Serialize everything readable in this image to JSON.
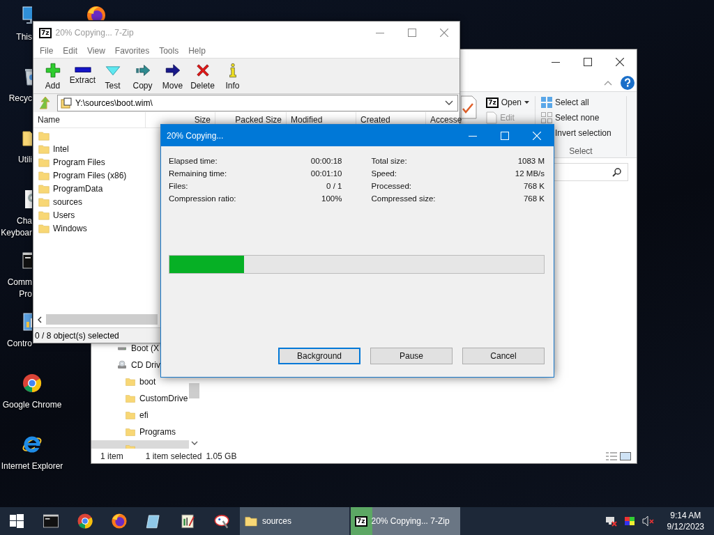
{
  "desktop_icons": [
    {
      "kind": "computer",
      "lines": [
        "This"
      ]
    },
    {
      "kind": "recycle-bin",
      "lines": [
        "Recyc"
      ]
    },
    {
      "kind": "folder",
      "lines": [
        "Utili"
      ]
    },
    {
      "kind": "settings",
      "lines": [
        "Cha",
        "Keyboar"
      ]
    },
    {
      "kind": "terminal",
      "lines": [
        "Comm",
        "Pro"
      ]
    },
    {
      "kind": "control-panel",
      "lines": [
        "Contro"
      ]
    },
    {
      "kind": "chrome",
      "lines": [
        "Google Chrome"
      ]
    },
    {
      "kind": "ie",
      "lines": [
        "Internet Explorer"
      ]
    }
  ],
  "explorer": {
    "ribbon": {
      "open_logo": "7z",
      "open": "Open",
      "edit": "Edit",
      "select_all": "Select all",
      "select_none": "Select none",
      "invert_selection": "Invert selection",
      "group_label": "Select"
    },
    "nav_items": [
      {
        "kind": "drive",
        "label": "Boot (X",
        "selected": false
      },
      {
        "kind": "cd-drive",
        "label": "CD Driv",
        "selected": false,
        "children": [
          {
            "kind": "folder",
            "label": "boot",
            "selected": false
          },
          {
            "kind": "folder",
            "label": "CustomDrive",
            "selected": false
          },
          {
            "kind": "folder",
            "label": "efi",
            "selected": false
          },
          {
            "kind": "folder",
            "label": "Programs",
            "selected": false
          },
          {
            "kind": "folder",
            "selected": true
          }
        ]
      }
    ],
    "status": {
      "count": "1 item",
      "selection": "1 item selected",
      "size": "1.05 GB"
    }
  },
  "zip_window": {
    "logo": "7z",
    "title": "20% Copying... 7-Zip",
    "menu": [
      "File",
      "Edit",
      "View",
      "Favorites",
      "Tools",
      "Help"
    ],
    "toolbar": [
      {
        "kind": "add",
        "label": "Add"
      },
      {
        "kind": "extract",
        "label": "Extract"
      },
      {
        "kind": "test",
        "label": "Test"
      },
      {
        "kind": "copy",
        "label": "Copy"
      },
      {
        "kind": "move",
        "label": "Move"
      },
      {
        "kind": "delete",
        "label": "Delete"
      },
      {
        "kind": "info",
        "label": "Info"
      }
    ],
    "address": "Y:\\sources\\boot.wim\\",
    "columns": [
      "Name",
      "Size",
      "Packed Size",
      "Modified",
      "Created",
      "Accesse"
    ],
    "rows": [
      {
        "kind": "folder"
      },
      {
        "kind": "folder",
        "name": "Intel"
      },
      {
        "kind": "folder",
        "name": "Program Files"
      },
      {
        "kind": "folder",
        "name": "Program Files (x86)"
      },
      {
        "kind": "folder",
        "name": "ProgramData"
      },
      {
        "kind": "folder",
        "name": "sources"
      },
      {
        "kind": "folder",
        "name": "Users"
      },
      {
        "kind": "folder",
        "name": "Windows"
      }
    ],
    "status": "0 / 8 object(s) selected"
  },
  "progress_dialog": {
    "title": "20% Copying...",
    "left_stats": [
      {
        "label": "Elapsed time:",
        "value": "00:00:18"
      },
      {
        "label": "Remaining time:",
        "value": "00:01:10"
      },
      {
        "label": "Files:",
        "value": "0 / 1"
      },
      {
        "label": "Compression ratio:",
        "value": "100%"
      }
    ],
    "right_stats": [
      {
        "label": "Total size:",
        "value": "1083 M"
      },
      {
        "label": "Speed:",
        "value": "12 MB/s"
      },
      {
        "label": "Processed:",
        "value": "768 K"
      },
      {
        "label": "Compressed size:",
        "value": "768 K"
      }
    ],
    "level": 0.2,
    "buttons": [
      {
        "label": "Background",
        "selected": true
      },
      {
        "label": "Pause",
        "selected": false
      },
      {
        "label": "Cancel",
        "selected": false
      }
    ]
  },
  "taskbar": {
    "pinned": [
      {
        "kind": "terminal"
      },
      {
        "kind": "chrome"
      },
      {
        "kind": "firefox"
      },
      {
        "kind": "notes"
      },
      {
        "kind": "notepad"
      },
      {
        "kind": "paint"
      }
    ],
    "tasks": [
      {
        "kind": "folder",
        "label": "sources",
        "selected": false
      },
      {
        "kind": "archiver",
        "logo": "7z",
        "label": "20% Copying... 7-Zip",
        "selected": true,
        "level": 0.2
      }
    ],
    "clock": {
      "time": "9:14 AM",
      "date": "9/12/2023"
    }
  }
}
